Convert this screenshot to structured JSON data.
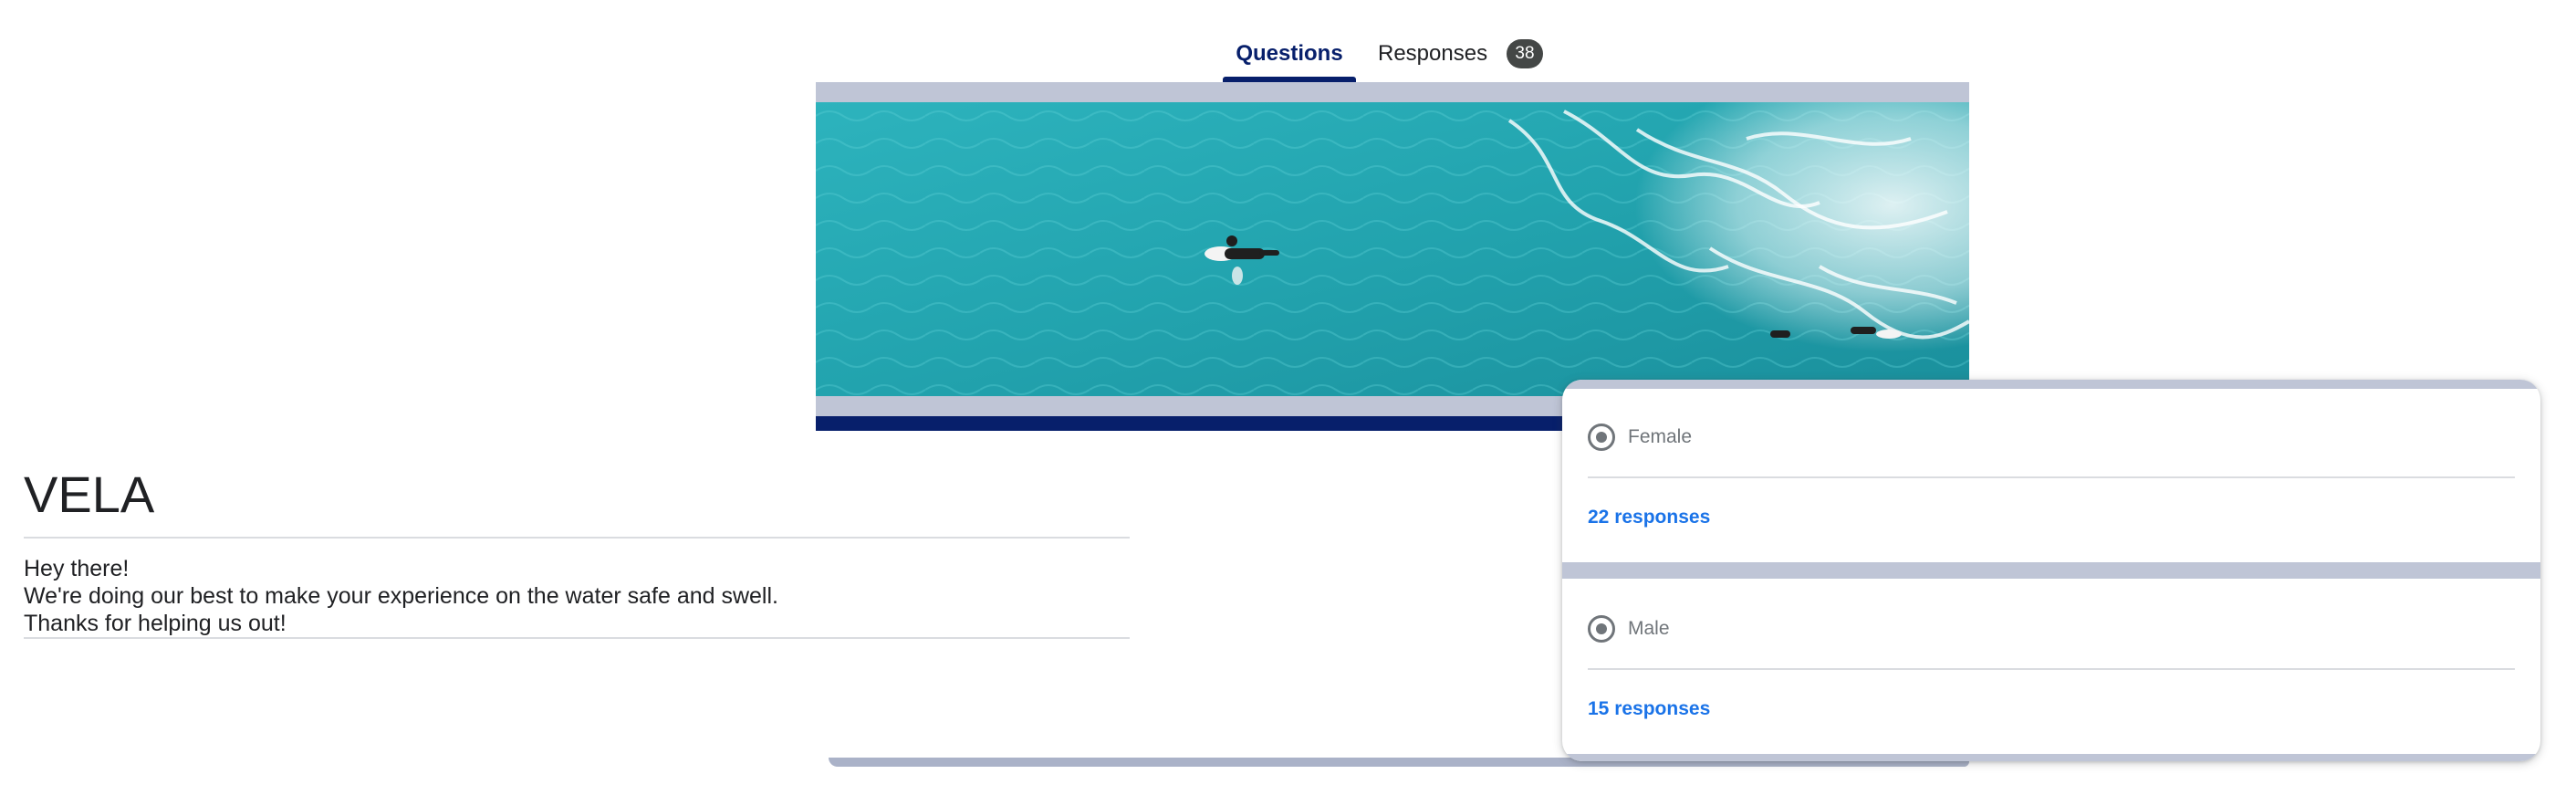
{
  "tabs": {
    "questions_label": "Questions",
    "responses_label": "Responses",
    "responses_count": "38",
    "active": "Questions"
  },
  "form": {
    "title": "VELA",
    "description_lines": [
      "Hey there!",
      "We're doing our best to make your experience on the water safe and swell.",
      "Thanks for helping us out!"
    ]
  },
  "response_panel": {
    "options": [
      {
        "label": "Female",
        "responses": "22 responses"
      },
      {
        "label": "Male",
        "responses": "15 responses"
      }
    ]
  },
  "colors": {
    "accent": "#071f6b",
    "strip": "#bfc5d6",
    "link": "#1a73e8",
    "badge": "#444746"
  },
  "icons": {
    "radio": "radio-selected-icon"
  }
}
